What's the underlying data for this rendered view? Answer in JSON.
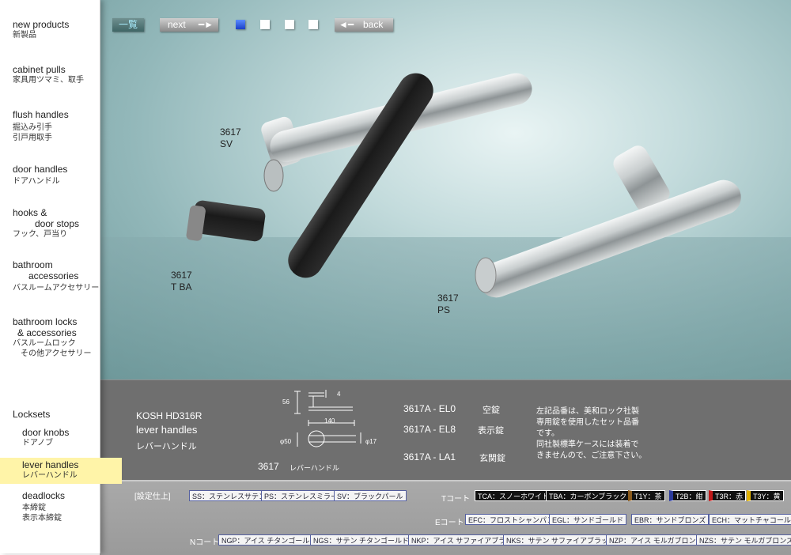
{
  "sidebar": {
    "new_products_en": "new products",
    "new_products_jp": "新製品",
    "cabinet_pulls_en": "cabinet pulls",
    "cabinet_pulls_jp": "家具用ツマミ、取手",
    "flush_handles_en": "flush handles",
    "flush_handles_jp1": "掘込み引手",
    "flush_handles_jp2": "引戸用取手",
    "door_handles_en": "door handles",
    "door_handles_jp": "ドアハンドル",
    "hooks_en1": "hooks &",
    "hooks_en2": "door stops",
    "hooks_jp": "フック、戸当り",
    "bathroom_acc_en1": "bathroom",
    "bathroom_acc_en2": "accessories",
    "bathroom_acc_jp": "バスルームアクセサリー",
    "bathroom_locks_en1": "bathroom locks",
    "bathroom_locks_en2": "& accessories",
    "bathroom_locks_jp1": "バスルームロック",
    "bathroom_locks_jp2": "その他アクセサリー",
    "locksets": "Locksets",
    "door_knobs_en": "door knobs",
    "door_knobs_jp": "ドアノブ",
    "lever_handles_en": "lever handles",
    "lever_handles_jp": "レバーハンドル",
    "deadlocks_en": "deadlocks",
    "deadlocks_jp1": "本締錠",
    "deadlocks_jp2": "表示本締錠"
  },
  "toolbar": {
    "list_label": "一覧",
    "next_label": "next",
    "back_label": "back"
  },
  "photo_labels": {
    "sv_num": "3617",
    "sv_code": "SV",
    "tba_num": "3617",
    "tba_code": "T BA",
    "ps_num": "3617",
    "ps_code": "PS"
  },
  "info": {
    "series": "KOSH HD316R",
    "title_en": "lever handles",
    "title_jp": "レバーハンドル",
    "dim_height": "56",
    "dim_thick": "4",
    "dim_length": "140",
    "dim_rose": "φ50",
    "dim_bar": "φ17",
    "model": "3617",
    "model_jp": "レバーハンドル",
    "sets": [
      {
        "code": "3617A - EL0",
        "name": "空錠"
      },
      {
        "code": "3617A - EL8",
        "name": "表示錠"
      },
      {
        "code": "3617A - LA1",
        "name": "玄関錠"
      }
    ],
    "note_lines": [
      "左記品番は、美和ロック社製",
      "専用錠を使用したセット品番",
      "です。",
      "同社製標準ケースには装着で",
      "きませんので、ご注意下さい。"
    ]
  },
  "finishes": {
    "spec_label": "[設定仕上]",
    "t_label": "Tコート",
    "e_label": "Eコート",
    "n_label": "Nコート",
    "standard": [
      "SS：ステンレスサテン",
      "PS：ステンレスミラー",
      "SV：ブラックパール"
    ],
    "t_coat": [
      "TCA：スノーホワイト",
      "TBA：カーボンブラック"
    ],
    "t_colors": [
      {
        "label": "T1Y：茶",
        "color": "#8a5a1c"
      },
      {
        "label": "T2B：紺",
        "color": "#2b3a9a"
      },
      {
        "label": "T3R：赤",
        "color": "#c01818"
      },
      {
        "label": "T3Y：黄",
        "color": "#e0b000"
      }
    ],
    "e_coat": [
      "EFC：フロストシャンパン",
      "EGL：サンドゴールド",
      "EBR：サンドブロンズ",
      "ECH：マットチャコール"
    ],
    "n_coat": [
      "NGP：アイス チタンゴールド",
      "NGS：サテン チタンゴールド",
      "NKP：アイス サファイアブラック",
      "NKS：サテン サファイアブラック",
      "NZP：アイス モルガブロンズ",
      "NZS：サテン モルガブロンズ"
    ]
  }
}
